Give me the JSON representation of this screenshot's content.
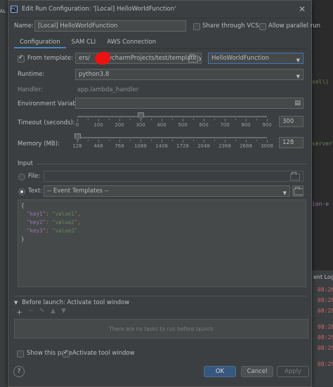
{
  "colors": {
    "accent": "#4a88c7",
    "primary_button": "#365880",
    "redaction": "#ee1111"
  },
  "background_ide": {
    "code_fragments": [
      "ool\\)",
      "server\\",
      "ion-e"
    ],
    "right_tab": "ent Log",
    "times": [
      "08:26",
      "08:26",
      "08:28",
      "08:28",
      "08:29",
      "08:29",
      "08:29"
    ],
    "left_marker": "AL"
  },
  "dialog": {
    "title": "Edit Run Configuration: '[Local] HelloWorldFunction'",
    "name_label": "Name:",
    "name_value": "[Local] HelloWorldFunction",
    "share_vcs": "Share through VCS",
    "allow_parallel": "Allow parallel run",
    "tabs": [
      {
        "label": "Configuration"
      },
      {
        "label": "SAM CLI"
      },
      {
        "label": "AWS Connection"
      }
    ],
    "from_template_label": "From template:",
    "template_path": "ers/",
    "template_path_rest": "/PycharmProjects/test/template.yaml",
    "function_select": "HelloWorldFunction",
    "runtime_label": "Runtime:",
    "runtime_value": "python3.8",
    "handler_label": "Handler:",
    "handler_value": "app.lambda_handler",
    "env_label": "Environment Variables:",
    "timeout_label": "Timeout (seconds):",
    "timeout_value": "300",
    "timeout_ticks": [
      "0",
      "100",
      "200",
      "300",
      "400",
      "500",
      "600",
      "700",
      "800",
      "900"
    ],
    "timeout_level": 0.333,
    "memory_label": "Memory (MB):",
    "memory_value": "128",
    "memory_ticks": [
      "128",
      "448",
      "768",
      "1088",
      "1408",
      "1728",
      "2048",
      "2368",
      "2688",
      "3008"
    ],
    "memory_level": 0.0,
    "input_label": "Input",
    "file_label": "File:",
    "text_label": "Text:",
    "event_templates": "-- Event Templates --",
    "json_lines": [
      {
        "type": "brace",
        "text": "{"
      },
      {
        "type": "pair",
        "key": "\"key1\"",
        "value": "\"value1\"",
        "comma": true
      },
      {
        "type": "pair",
        "key": "\"key2\"",
        "value": "\"value2\"",
        "comma": true
      },
      {
        "type": "pair",
        "key": "\"key3\"",
        "value": "\"value3\"",
        "comma": false
      },
      {
        "type": "brace",
        "text": "}"
      }
    ],
    "before_launch": "Before launch: Activate tool window",
    "no_tasks": "There are no tasks to run before launch",
    "show_page": "Show this page",
    "activate_tool_window": "Activate tool window",
    "ok": "OK",
    "cancel": "Cancel",
    "apply": "Apply",
    "help": "?"
  }
}
